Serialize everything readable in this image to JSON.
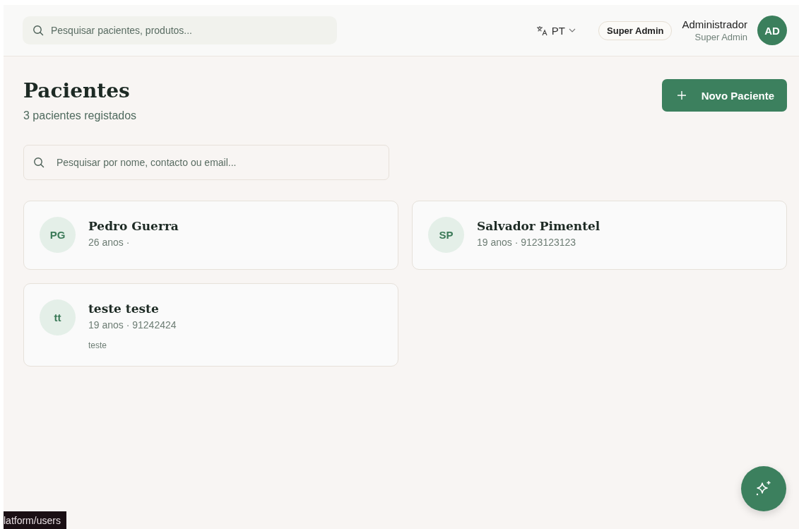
{
  "header": {
    "search": {
      "placeholder": "Pesquisar pacientes, produtos..."
    },
    "language": "PT",
    "role_badge": "Super Admin",
    "user": {
      "name": "Administrador",
      "role": "Super Admin",
      "initials": "AD"
    }
  },
  "page": {
    "title": "Pacientes",
    "subtitle": "3 pacientes registados",
    "new_button": "Novo Paciente",
    "search": {
      "placeholder": "Pesquisar por nome, contacto ou email..."
    }
  },
  "patients": [
    {
      "initials": "PG",
      "name": "Pedro Guerra",
      "details": "26 anos ·"
    },
    {
      "initials": "SP",
      "name": "Salvador Pimentel",
      "details": "19 anos · 9123123123"
    },
    {
      "initials": "tt",
      "name": "teste teste",
      "details": "19 anos · 91242424",
      "note": "teste"
    }
  ],
  "status_url": "latform/users"
}
